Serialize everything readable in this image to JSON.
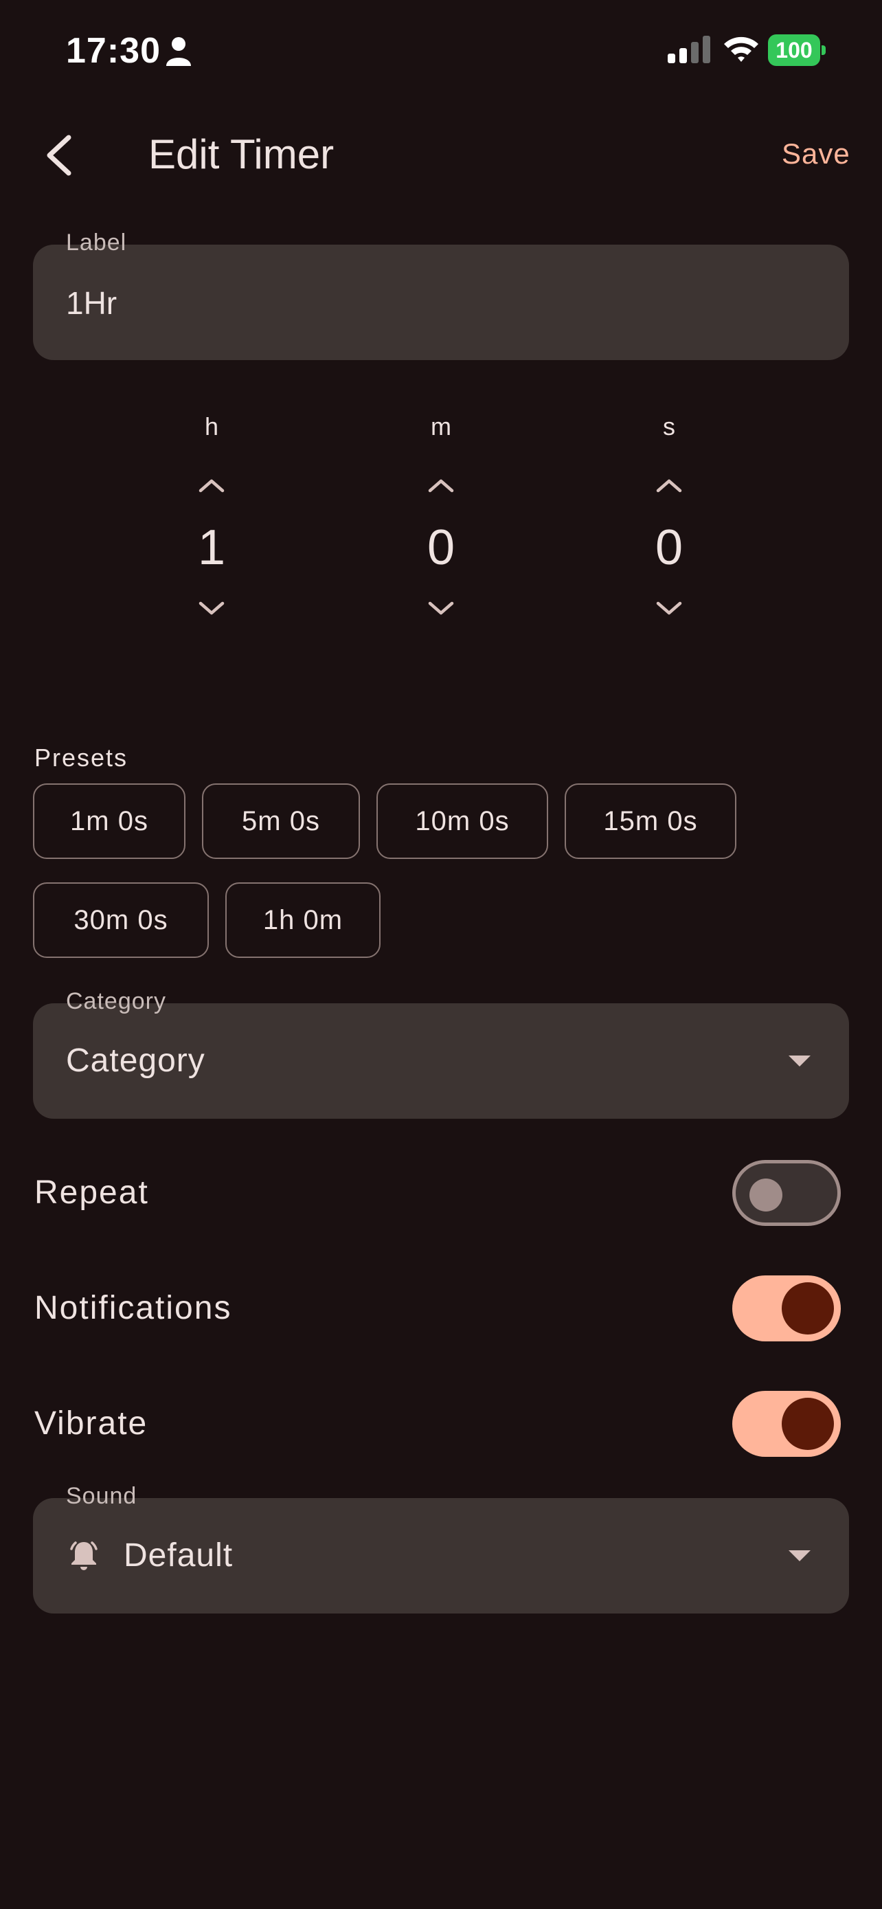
{
  "status_bar": {
    "time": "17:30",
    "battery": "100"
  },
  "header": {
    "title": "Edit Timer",
    "save_label": "Save"
  },
  "label_field": {
    "label": "Label",
    "value": "1Hr"
  },
  "time_picker": {
    "hours": {
      "unit": "h",
      "value": "1"
    },
    "minutes": {
      "unit": "m",
      "value": "0"
    },
    "seconds": {
      "unit": "s",
      "value": "0"
    }
  },
  "presets": {
    "title": "Presets",
    "items": [
      "1m 0s",
      "5m 0s",
      "10m 0s",
      "15m 0s",
      "30m 0s",
      "1h 0m"
    ]
  },
  "category_field": {
    "label": "Category",
    "value": "Category"
  },
  "settings": {
    "repeat": {
      "label": "Repeat",
      "on": false
    },
    "notifications": {
      "label": "Notifications",
      "on": true
    },
    "vibrate": {
      "label": "Vibrate",
      "on": true
    }
  },
  "sound_field": {
    "label": "Sound",
    "value": "Default",
    "icon": "bell-icon"
  },
  "colors": {
    "background": "#1a1011",
    "accent": "#ffb59a",
    "field": "#3d3432",
    "knob_on": "#5c1a08"
  }
}
